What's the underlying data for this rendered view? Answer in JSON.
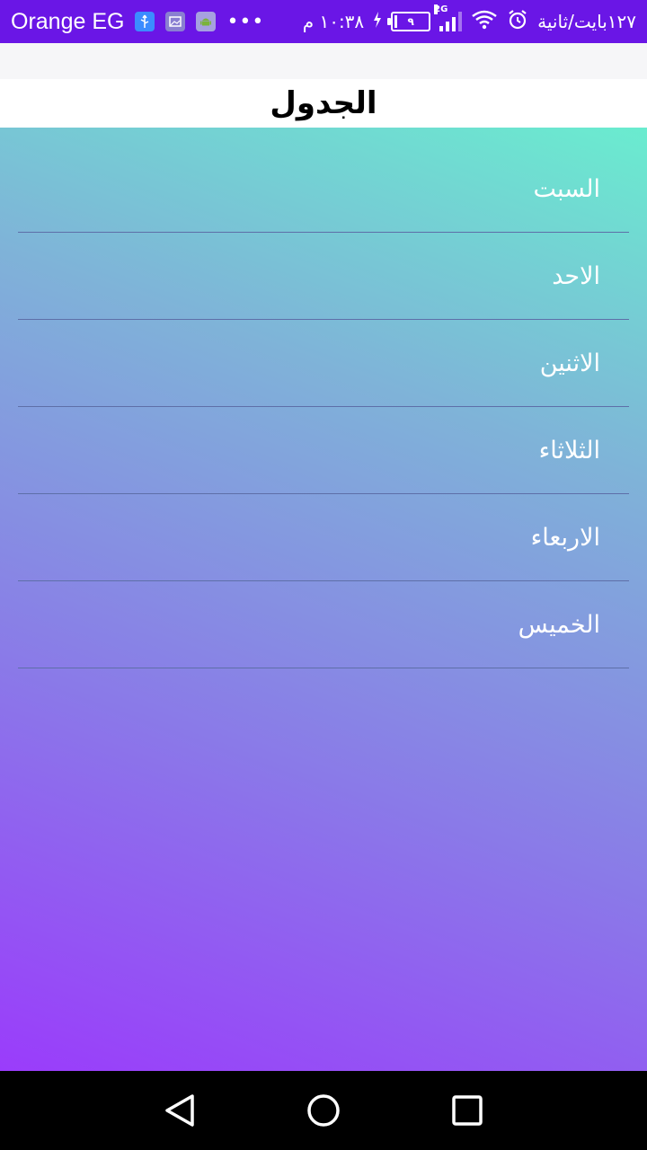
{
  "status_bar": {
    "carrier": "Orange EG",
    "speed": "١٢٧بايت/ثانية",
    "network_type": "2G",
    "battery_level": "٩",
    "battery_fraction": 0.09,
    "time": "١٠:٣٨ م",
    "icons": [
      "usb-icon",
      "image-icon",
      "android-icon",
      "more-dots-icon",
      "alarm-icon",
      "wifi-icon",
      "signal-icon",
      "battery-icon",
      "charging-icon"
    ]
  },
  "header": {
    "title": "الجدول"
  },
  "days": [
    {
      "label": "السبت"
    },
    {
      "label": "الاحد"
    },
    {
      "label": "الاثنين"
    },
    {
      "label": "الثلاثاء"
    },
    {
      "label": "الاربعاء"
    },
    {
      "label": "الخميس"
    }
  ],
  "nav": {
    "icons": [
      "back-icon",
      "home-icon",
      "recents-icon"
    ]
  },
  "colors": {
    "status_bar": "#6a16e6",
    "gradient_top": "#6aeccf",
    "gradient_bottom": "#9a3cfb",
    "divider": "#5e6fa8"
  }
}
